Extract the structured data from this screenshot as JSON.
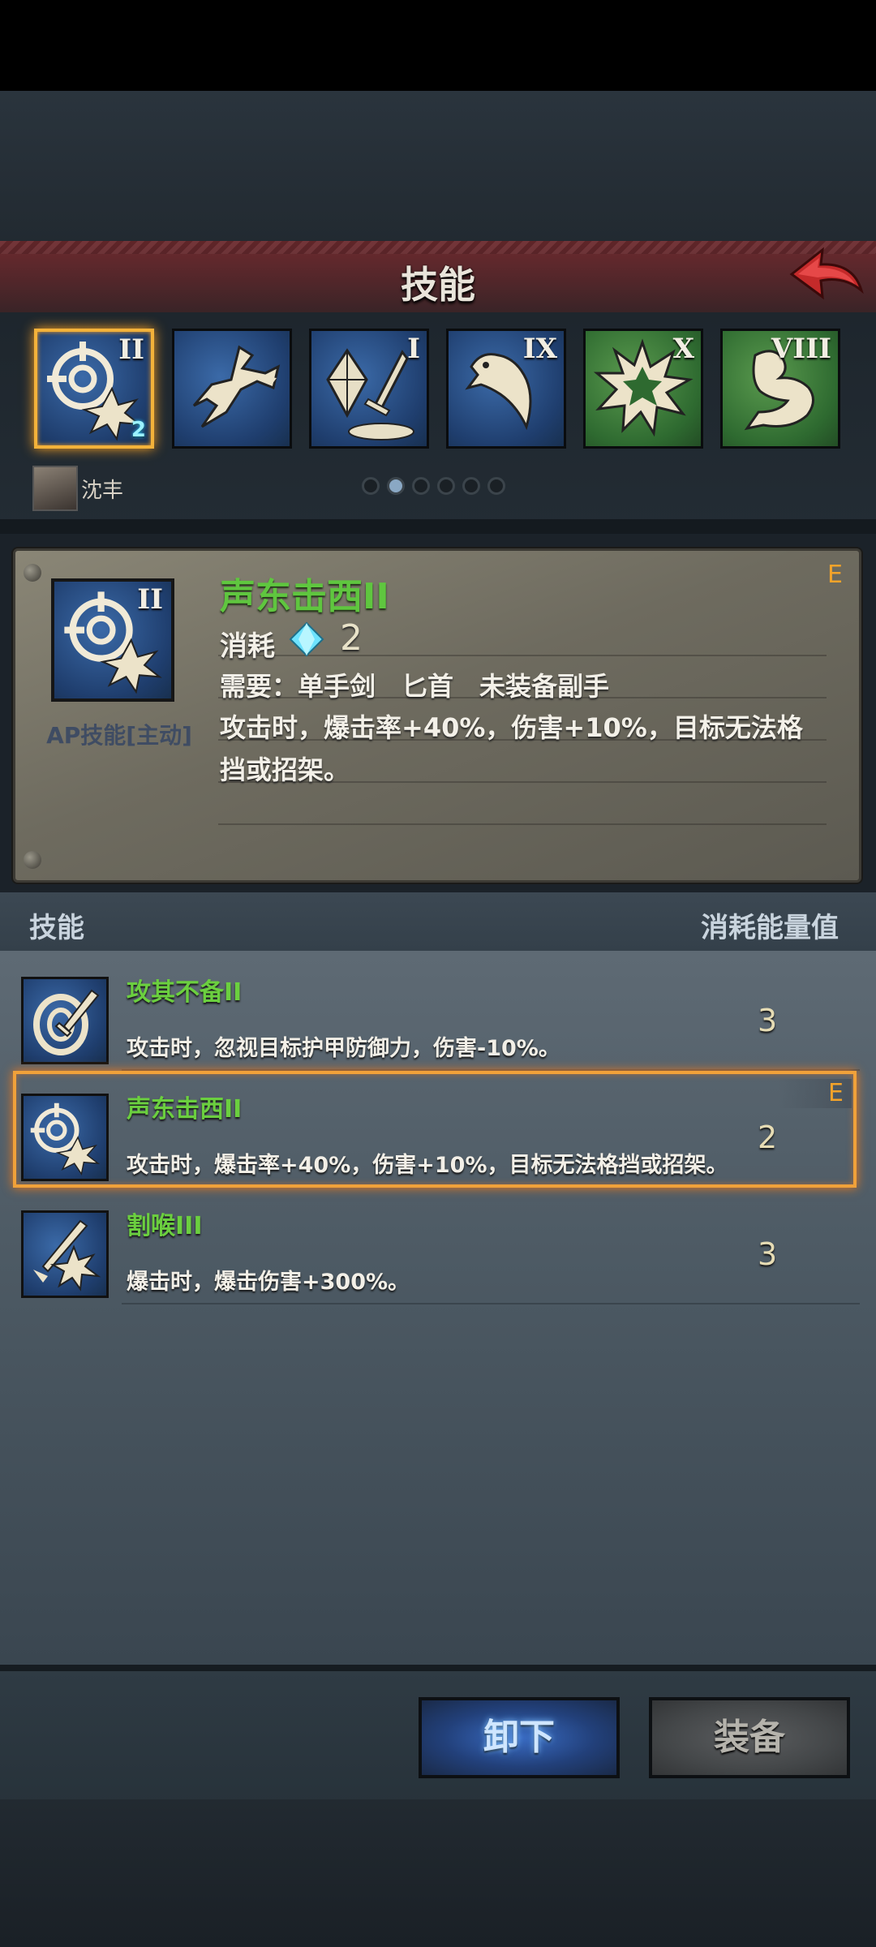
{
  "header": {
    "title": "技能"
  },
  "skill_slots": [
    {
      "numeral": "II",
      "cost": "2",
      "color": "blue",
      "selected": true,
      "icon": "crosshair-burst-icon"
    },
    {
      "numeral": "",
      "color": "blue",
      "icon": "dash-strike-icon"
    },
    {
      "numeral": "I",
      "color": "blue",
      "icon": "crystal-sword-icon"
    },
    {
      "numeral": "IX",
      "color": "blue",
      "icon": "hawk-icon"
    },
    {
      "numeral": "X",
      "color": "green",
      "icon": "explosion-icon"
    },
    {
      "numeral": "VIII",
      "color": "green",
      "icon": "flex-arm-icon"
    }
  ],
  "character": {
    "name": "沈丰"
  },
  "pagination": {
    "total": 6,
    "active_index": 1
  },
  "detail": {
    "numeral": "II",
    "name": "声东击西II",
    "grade": "E",
    "type": "AP技能[主动]",
    "cost_label": "消耗",
    "cost_value": "2",
    "requirement": "需要：单手剑　匕首　未装备副手",
    "description": "攻击时，爆击率+40%，伤害+10%，目标无法格挡或招架。"
  },
  "list_header": {
    "left": "技能",
    "right": "消耗能量值"
  },
  "skills_list": [
    {
      "name": "攻其不备II",
      "description": "攻击时，忽视目标护甲防御力，伤害-10%。",
      "cost": "3",
      "grade": "",
      "selected": false,
      "icon": "shield-sword-icon"
    },
    {
      "name": "声东击西II",
      "description": "攻击时，爆击率+40%，伤害+10%，目标无法格挡或招架。",
      "cost": "2",
      "grade": "E",
      "selected": true,
      "icon": "crosshair-burst-icon"
    },
    {
      "name": "割喉III",
      "description": "爆击时，爆击伤害+300%。",
      "cost": "3",
      "grade": "",
      "selected": false,
      "icon": "dagger-burst-icon"
    }
  ],
  "buttons": {
    "unequip": "卸下",
    "equip": "装备"
  },
  "colors": {
    "accent_orange": "#f3a32a",
    "skill_name_green": "#6bcf3f",
    "gem_cyan": "#6ee3ff"
  }
}
